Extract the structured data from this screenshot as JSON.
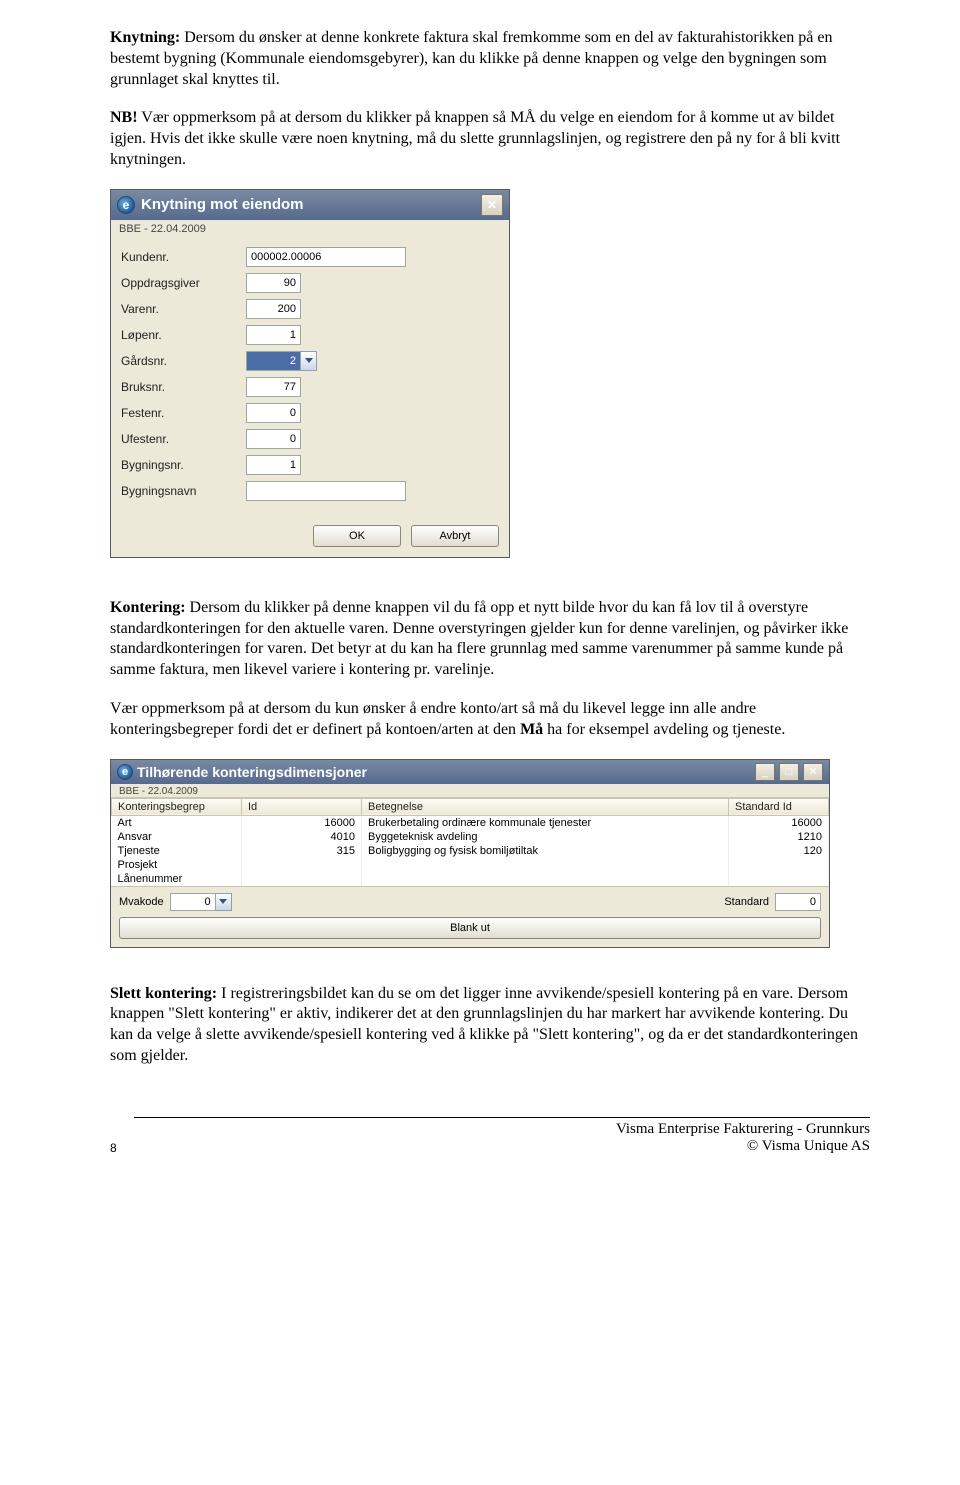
{
  "para1": {
    "lead": "Knytning:",
    "text": " Dersom du ønsker at denne konkrete faktura skal fremkomme som en del av fakturahistorikken på en bestemt bygning (Kommunale eiendomsgebyrer), kan du klikke på denne knappen og velge den bygningen som grunnlaget skal knyttes til."
  },
  "para2": {
    "lead": "NB!",
    "text": " Vær oppmerksom på at dersom du klikker på knappen så MÅ du velge en eiendom for å komme ut av bildet igjen. Hvis det ikke skulle være noen knytning, må du slette grunnlagslinjen, og registrere den på ny for å bli kvitt knytningen."
  },
  "dialog1": {
    "title": "Knytning mot eiendom",
    "subtitle": "BBE - 22.04.2009",
    "labels": {
      "kundenr": "Kundenr.",
      "oppdragsgiver": "Oppdragsgiver",
      "varenr": "Varenr.",
      "lopenr": "Løpenr.",
      "gardsnr": "Gårdsnr.",
      "bruksnr": "Bruksnr.",
      "festenr": "Festenr.",
      "ufestenr": "Ufestenr.",
      "bygningsnr": "Bygningsnr.",
      "bygningsnavn": "Bygningsnavn"
    },
    "values": {
      "kundenr": "000002.00006",
      "oppdragsgiver": "90",
      "varenr": "200",
      "lopenr": "1",
      "gardsnr": "2",
      "bruksnr": "77",
      "festenr": "0",
      "ufestenr": "0",
      "bygningsnr": "1",
      "bygningsnavn": ""
    },
    "buttons": {
      "ok": "OK",
      "cancel": "Avbryt"
    }
  },
  "para3": {
    "lead": "Kontering:",
    "text": " Dersom du klikker på denne knappen vil du få opp et nytt bilde hvor du kan få lov til å overstyre standardkonteringen for den aktuelle varen. Denne overstyringen gjelder kun for denne varelinjen, og påvirker ikke standardkonteringen for varen. Det betyr at du kan ha flere grunnlag med samme varenummer på samme kunde på samme faktura, men likevel variere i kontering pr. varelinje."
  },
  "para4": {
    "t1": "Vær oppmerksom på at dersom du kun ønsker å endre konto/art så må du likevel legge inn alle andre konteringsbegreper fordi det er definert på kontoen/arten at den ",
    "b": "Må",
    "t2": " ha for eksempel avdeling og tjeneste."
  },
  "dialog2": {
    "title": "Tilhørende konteringsdimensjoner",
    "subtitle": "BBE - 22.04.2009",
    "headers": {
      "begrep": "Konteringsbegrep",
      "id": "Id",
      "betegnelse": "Betegnelse",
      "std": "Standard Id"
    },
    "rows": [
      {
        "b": "Art",
        "id": "16000",
        "bet": "Brukerbetaling ordinære kommunale tjenester",
        "std": "16000"
      },
      {
        "b": "Ansvar",
        "id": "4010",
        "bet": "Byggeteknisk avdeling",
        "std": "1210"
      },
      {
        "b": "Tjeneste",
        "id": "315",
        "bet": "Boligbygging og fysisk bomiljøtiltak",
        "std": "120"
      },
      {
        "b": "Prosjekt",
        "id": "",
        "bet": "",
        "std": ""
      },
      {
        "b": "Lånenummer",
        "id": "",
        "bet": "",
        "std": ""
      }
    ],
    "footer": {
      "mva_label": "Mvakode",
      "mva_val": "0",
      "std_label": "Standard",
      "std_val": "0",
      "blank": "Blank ut"
    }
  },
  "para5": {
    "lead": "Slett kontering:",
    "text": " I registreringsbildet kan du se om det ligger inne avvikende/spesiell kontering på en vare. Dersom knappen \"Slett kontering\" er aktiv, indikerer det at den grunnlagslinjen du har markert har avvikende kontering. Du kan da velge å slette avvikende/spesiell kontering ved å klikke på \"Slett kontering\", og da er det standardkonteringen som gjelder."
  },
  "footer": {
    "page": "8",
    "line1": "Visma Enterprise Fakturering - Grunnkurs",
    "line2": "© Visma Unique AS"
  }
}
